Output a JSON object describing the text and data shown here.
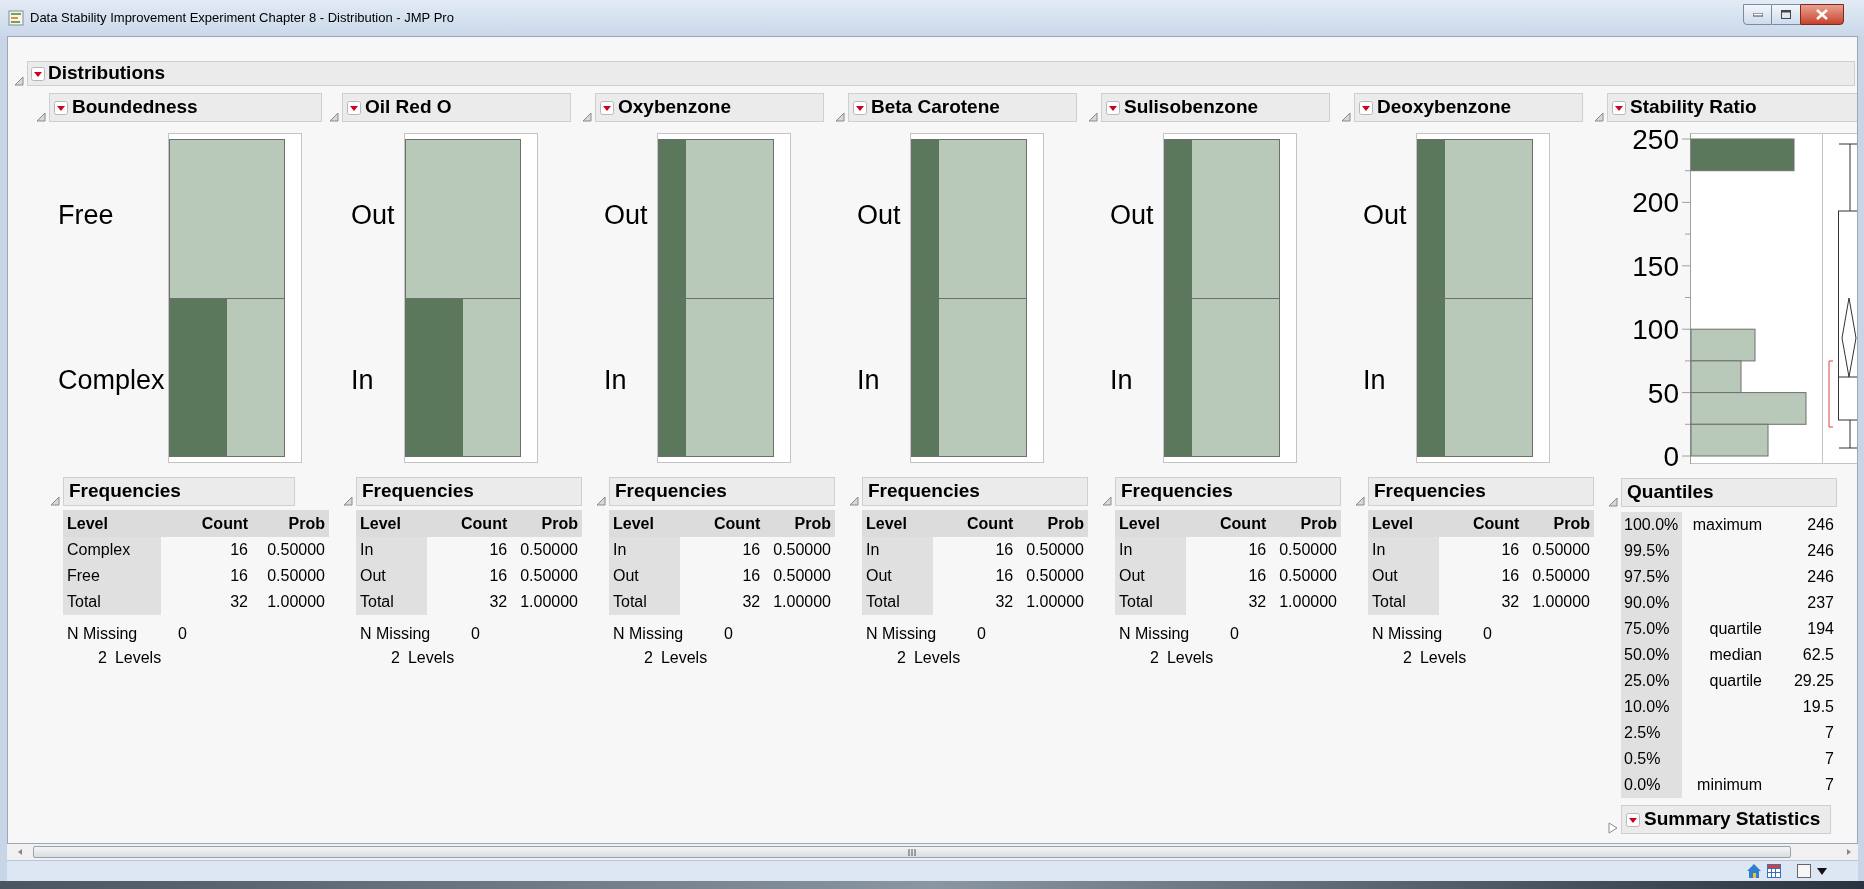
{
  "window": {
    "title": "Data Stability Improvement Experiment Chapter 8 - Distribution - JMP Pro"
  },
  "report": {
    "title": "Distributions",
    "expanded": true
  },
  "columns": [
    {
      "title": "Boundedness",
      "expanded": true,
      "bars": [
        {
          "label": "Free",
          "kind": "plain"
        },
        {
          "label": "Complex",
          "kind": "half"
        }
      ],
      "frequencies": {
        "title": "Frequencies",
        "expanded": true,
        "headers": [
          "Level",
          "Count",
          "Prob"
        ],
        "rows": [
          {
            "level": "Complex",
            "count": "16",
            "prob": "0.50000"
          },
          {
            "level": "Free",
            "count": "16",
            "prob": "0.50000"
          },
          {
            "level": "Total",
            "count": "32",
            "prob": "1.00000"
          }
        ],
        "n_missing": {
          "label": "N Missing",
          "value": "0"
        },
        "levels": {
          "count": "2",
          "label": "Levels"
        }
      }
    },
    {
      "title": "Oil Red O",
      "expanded": true,
      "bars": [
        {
          "label": "Out",
          "kind": "plain"
        },
        {
          "label": "In",
          "kind": "half"
        }
      ],
      "frequencies": {
        "title": "Frequencies",
        "expanded": true,
        "headers": [
          "Level",
          "Count",
          "Prob"
        ],
        "rows": [
          {
            "level": "In",
            "count": "16",
            "prob": "0.50000"
          },
          {
            "level": "Out",
            "count": "16",
            "prob": "0.50000"
          },
          {
            "level": "Total",
            "count": "32",
            "prob": "1.00000"
          }
        ],
        "n_missing": {
          "label": "N Missing",
          "value": "0"
        },
        "levels": {
          "count": "2",
          "label": "Levels"
        }
      }
    },
    {
      "title": "Oxybenzone",
      "expanded": true,
      "bars": [
        {
          "label": "Out",
          "kind": "quarter"
        },
        {
          "label": "In",
          "kind": "quarter"
        }
      ],
      "frequencies": {
        "title": "Frequencies",
        "expanded": true,
        "headers": [
          "Level",
          "Count",
          "Prob"
        ],
        "rows": [
          {
            "level": "In",
            "count": "16",
            "prob": "0.50000"
          },
          {
            "level": "Out",
            "count": "16",
            "prob": "0.50000"
          },
          {
            "level": "Total",
            "count": "32",
            "prob": "1.00000"
          }
        ],
        "n_missing": {
          "label": "N Missing",
          "value": "0"
        },
        "levels": {
          "count": "2",
          "label": "Levels"
        }
      }
    },
    {
      "title": "Beta Carotene",
      "expanded": true,
      "bars": [
        {
          "label": "Out",
          "kind": "quarter"
        },
        {
          "label": "In",
          "kind": "quarter"
        }
      ],
      "frequencies": {
        "title": "Frequencies",
        "expanded": true,
        "headers": [
          "Level",
          "Count",
          "Prob"
        ],
        "rows": [
          {
            "level": "In",
            "count": "16",
            "prob": "0.50000"
          },
          {
            "level": "Out",
            "count": "16",
            "prob": "0.50000"
          },
          {
            "level": "Total",
            "count": "32",
            "prob": "1.00000"
          }
        ],
        "n_missing": {
          "label": "N Missing",
          "value": "0"
        },
        "levels": {
          "count": "2",
          "label": "Levels"
        }
      }
    },
    {
      "title": "Sulisobenzone",
      "expanded": true,
      "bars": [
        {
          "label": "Out",
          "kind": "quarter"
        },
        {
          "label": "In",
          "kind": "quarter"
        }
      ],
      "frequencies": {
        "title": "Frequencies",
        "expanded": true,
        "headers": [
          "Level",
          "Count",
          "Prob"
        ],
        "rows": [
          {
            "level": "In",
            "count": "16",
            "prob": "0.50000"
          },
          {
            "level": "Out",
            "count": "16",
            "prob": "0.50000"
          },
          {
            "level": "Total",
            "count": "32",
            "prob": "1.00000"
          }
        ],
        "n_missing": {
          "label": "N Missing",
          "value": "0"
        },
        "levels": {
          "count": "2",
          "label": "Levels"
        }
      }
    },
    {
      "title": "Deoxybenzone",
      "expanded": true,
      "bars": [
        {
          "label": "Out",
          "kind": "quarter"
        },
        {
          "label": "In",
          "kind": "quarter"
        }
      ],
      "frequencies": {
        "title": "Frequencies",
        "expanded": true,
        "headers": [
          "Level",
          "Count",
          "Prob"
        ],
        "rows": [
          {
            "level": "In",
            "count": "16",
            "prob": "0.50000"
          },
          {
            "level": "Out",
            "count": "16",
            "prob": "0.50000"
          },
          {
            "level": "Total",
            "count": "32",
            "prob": "1.00000"
          }
        ],
        "n_missing": {
          "label": "N Missing",
          "value": "0"
        },
        "levels": {
          "count": "2",
          "label": "Levels"
        }
      }
    }
  ],
  "stability": {
    "title": "Stability Ratio",
    "expanded": true,
    "axis_labels": [
      "250",
      "200",
      "150",
      "100",
      "50",
      "0"
    ],
    "quantiles": {
      "title": "Quantiles",
      "expanded": true,
      "rows": [
        {
          "percent": "100.0%",
          "label": "maximum",
          "value": "246"
        },
        {
          "percent": "99.5%",
          "value": "246"
        },
        {
          "percent": "97.5%",
          "value": "246"
        },
        {
          "percent": "90.0%",
          "value": "237"
        },
        {
          "percent": "75.0%",
          "label": "quartile",
          "value": "194"
        },
        {
          "percent": "50.0%",
          "label": "median",
          "value": "62.5"
        },
        {
          "percent": "25.0%",
          "label": "quartile",
          "value": "29.25"
        },
        {
          "percent": "10.0%",
          "value": "19.5"
        },
        {
          "percent": "2.5%",
          "value": "7"
        },
        {
          "percent": "0.5%",
          "value": "7"
        },
        {
          "percent": "0.0%",
          "label": "minimum",
          "value": "7"
        }
      ]
    },
    "summary": {
      "title": "Summary Statistics",
      "expanded": false
    }
  }
}
